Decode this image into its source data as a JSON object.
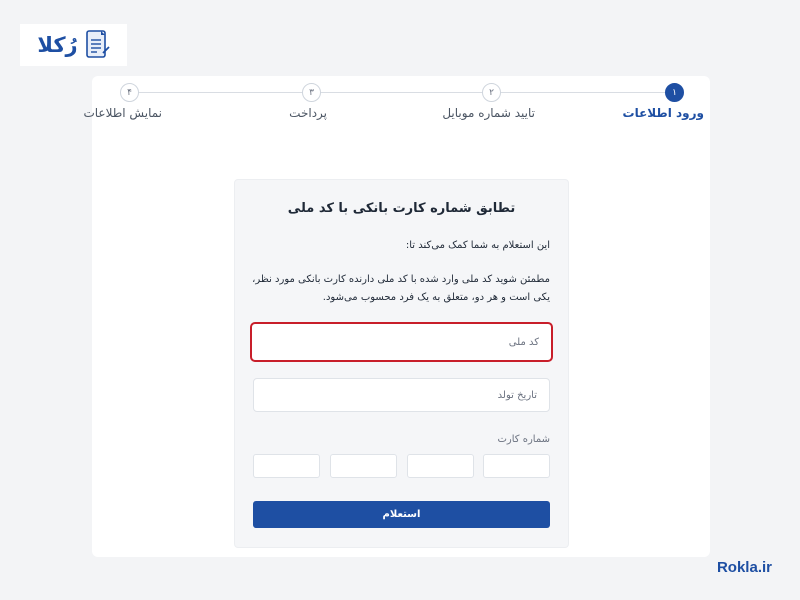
{
  "brand": {
    "logo_text": "رُکلا",
    "url": "Rokla.ir",
    "accent": "#1e4fa3"
  },
  "stepper": {
    "steps": [
      {
        "number": "۱",
        "label": "ورود اطلاعات",
        "active": true
      },
      {
        "number": "۲",
        "label": "تایید شماره موبایل",
        "active": false
      },
      {
        "number": "۳",
        "label": "پرداخت",
        "active": false
      },
      {
        "number": "۴",
        "label": "نمایش اطلاعات",
        "active": false
      }
    ]
  },
  "form": {
    "title": "تطابق شماره کارت بانکی با کد ملی",
    "intro": "این استعلام به شما کمک می‌کند تا:",
    "description": "مطمئن شوید کد ملی وارد شده با کد ملی دارنده کارت بانکی مورد نظر، یکی است و هر دو، متعلق به یک فرد محسوب می‌شود.",
    "national_code": {
      "placeholder": "کد ملی",
      "value": ""
    },
    "birth_date": {
      "placeholder": "تاریخ تولد",
      "value": ""
    },
    "card_number_label": "شماره کارت",
    "submit_label": "استعلام"
  },
  "colors": {
    "highlight": "#c81e2a",
    "primary": "#1e4fa3"
  }
}
